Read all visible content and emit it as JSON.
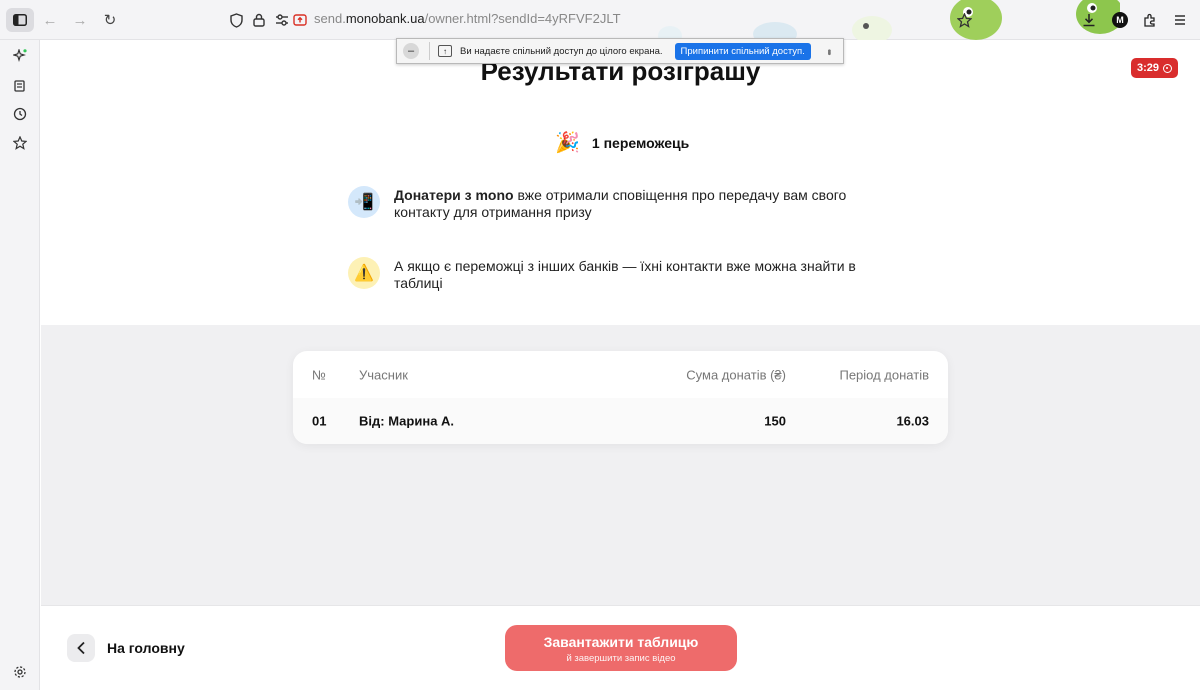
{
  "browser": {
    "url_prefix": "send.",
    "url_host": "monobank.ua",
    "url_path": "/owner.html?sendId=4yRFVF2JLT",
    "profile_initial": "M"
  },
  "share_bar": {
    "message": "Ви надаєте спільний доступ до цілого екрана.",
    "stop_label": "Припинити спільний доступ."
  },
  "page": {
    "title": "Результати розіграшу",
    "timer": "3:29",
    "winners_label": "1 переможець",
    "info": [
      {
        "bold": "Донатери з mono",
        "text": " вже отримали сповіщення про передачу вам свого контакту для отримання призу"
      },
      {
        "bold": "",
        "text": "А якщо є переможці з інших банків — їхні контакти вже можна знайти в таблиці"
      }
    ]
  },
  "table": {
    "headers": {
      "num": "№",
      "name": "Учасник",
      "sum": "Сума донатів (₴)",
      "period": "Період донатів"
    },
    "rows": [
      {
        "num": "01",
        "name": "Від: Марина А.",
        "sum": "150",
        "period": "16.03"
      }
    ]
  },
  "footer": {
    "back_label": "На головну",
    "download_label": "Завантажити таблицю",
    "download_sublabel": "й завершити запис відео"
  },
  "colors": {
    "accent": "#ee6b6b",
    "timer": "#d92d2d",
    "share_button": "#1a73e8"
  },
  "icons": [
    "sidebar-toggle-icon",
    "back-arrow-icon",
    "forward-arrow-icon",
    "reload-icon",
    "shield-icon",
    "lock-icon",
    "permissions-icon",
    "screen-share-icon",
    "bookmark-star-icon",
    "download-icon",
    "extensions-icon",
    "menu-icon",
    "ai-sparkle-icon",
    "wallet-icon",
    "history-icon",
    "favorites-icon",
    "settings-gear-icon",
    "party-popper-icon",
    "phone-icon",
    "warning-icon",
    "chevron-left-icon"
  ]
}
